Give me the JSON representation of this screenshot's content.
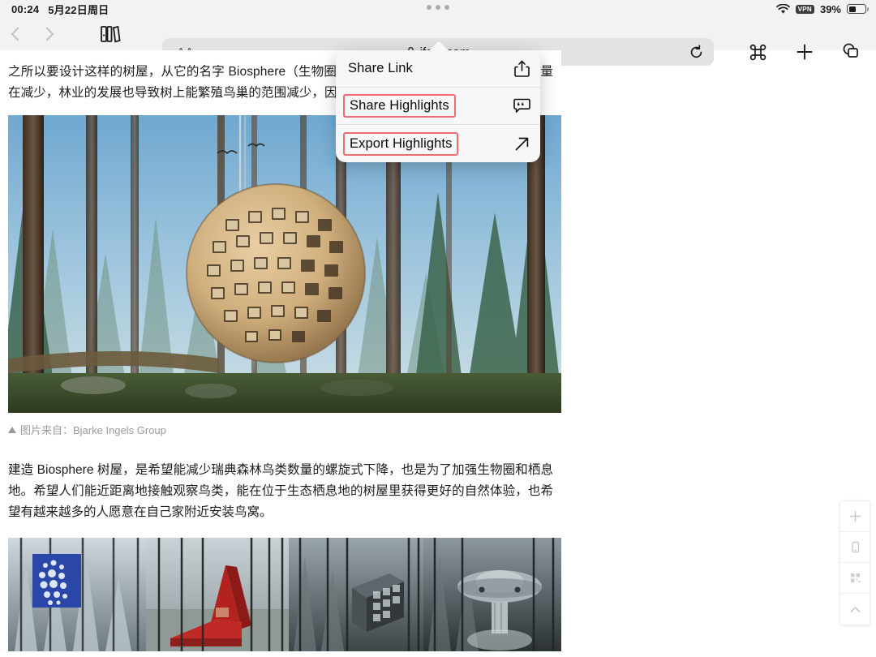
{
  "status_bar": {
    "time": "00:24",
    "date": "5月22日周日",
    "battery_percent": "39%",
    "wifi_icon": "wifi-icon",
    "vpn_label": "VPN",
    "battery_icon": "battery-icon",
    "multitask_handle": "three-dot-handle"
  },
  "toolbar": {
    "back_icon": "chevron-left-icon",
    "forward_icon": "chevron-right-icon",
    "bookmarks_icon": "books-icon",
    "text_size_label": "AA",
    "lock_icon": "lock-icon",
    "url": "ifanr.com",
    "reload_icon": "reload-icon",
    "command_icon": "command-icon",
    "new_tab_icon": "plus-icon",
    "tabs_icon": "tabs-icon"
  },
  "popup_menu": {
    "items": [
      {
        "label": "Share Link",
        "icon": "share-icon",
        "highlighted": false
      },
      {
        "label": "Share Highlights",
        "icon": "quote-bubble-icon",
        "highlighted": true
      },
      {
        "label": "Export Highlights",
        "icon": "arrow-up-right-icon",
        "highlighted": true
      }
    ],
    "highlight_color": "#f16b72"
  },
  "article": {
    "paragraph_top": "之所以要设计这样的树屋，从它的名字 Biosphere（生物圈）就能略知一二。瑞典的森林鸟类数量在减少，林业的发展也导致树上能繁殖鸟巢的范围减少，因此人工",
    "hero_image_alt": "Biosphere 球形树屋悬挂在瑞典松树林中",
    "image_credit": "图片来自：Bjarke Ingels Group",
    "credit_marker": "▲",
    "paragraph_bottom": "建造 Biosphere 树屋，是希望能减少瑞典森林鸟类数量的螺旋式下降，也是为了加强生物圈和栖息地。希望人们能近距离地接触观察鸟类，能在位于生态栖息地的树屋里获得更好的自然体验，也希望有越来越多的人愿意在自己家附近安装鸟窝。",
    "collage_image_alt": "Treehotel 四宫格：镜面树屋、红色锥形屋、立方体树屋、UFO 树屋"
  },
  "side_toolbar": {
    "items": [
      {
        "icon": "plus-icon"
      },
      {
        "icon": "mobile-icon"
      },
      {
        "icon": "qrcode-icon"
      },
      {
        "icon": "chevron-up-icon"
      }
    ]
  }
}
